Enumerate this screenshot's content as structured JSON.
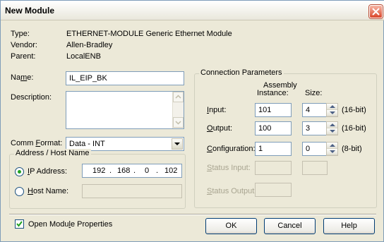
{
  "window": {
    "title": "New Module"
  },
  "info": {
    "type_label": "Type:",
    "type_value": "ETHERNET-MODULE Generic Ethernet Module",
    "vendor_label": "Vendor:",
    "vendor_value": "Allen-Bradley",
    "parent_label": "Parent:",
    "parent_value": "LocalENB"
  },
  "name": {
    "label_pre": "Na",
    "label_ul": "m",
    "label_post": "e:",
    "value": "IL_EIP_BK"
  },
  "description": {
    "label": "Description:",
    "value": ""
  },
  "comm_format": {
    "label_pre": "Comm ",
    "label_ul": "F",
    "label_post": "ormat:",
    "value": "Data - INT"
  },
  "address_group": {
    "title": "Address / Host Name",
    "ip_label_pre": "",
    "ip_label_ul": "I",
    "ip_label_post": "P Address:",
    "ip_octets": [
      "192",
      "168",
      "0",
      "102"
    ],
    "ip_selected": true,
    "host_label_pre": "",
    "host_label_ul": "H",
    "host_label_post": "ost Name:",
    "host_value": ""
  },
  "connection": {
    "title": "Connection Parameters",
    "col_assembly_line1": "Assembly",
    "col_assembly_line2": "Instance:",
    "col_size": "Size:",
    "rows": [
      {
        "label_ul": "I",
        "label_post": "nput:",
        "instance": "101",
        "size": "4",
        "unit": "(16-bit)",
        "enabled": true
      },
      {
        "label_ul": "O",
        "label_post": "utput:",
        "instance": "100",
        "size": "3",
        "unit": "(16-bit)",
        "enabled": true
      },
      {
        "label_ul": "C",
        "label_post": "onfiguration:",
        "instance": "1",
        "size": "0",
        "unit": "(8-bit)",
        "enabled": true
      },
      {
        "label_ul": "S",
        "label_post": "tatus Input:",
        "instance": "",
        "size": "",
        "unit": "",
        "enabled": false
      },
      {
        "label_ul": "S",
        "label_post": "tatus Output:",
        "instance": "",
        "size": "",
        "unit": "",
        "enabled": false
      }
    ]
  },
  "footer": {
    "open_props_pre": "Open Modu",
    "open_props_ul": "l",
    "open_props_post": "e Properties",
    "open_props_checked": true,
    "ok_label": "OK",
    "cancel_label": "Cancel",
    "help_label": "Help"
  },
  "colors": {
    "title_close": "#d9452a",
    "field_border": "#7f9db9",
    "dialog_bg": "#ece9d8"
  },
  "icons": [
    "close-icon",
    "scroll-up-icon",
    "scroll-down-icon",
    "dropdown-arrow-icon",
    "spin-up-icon",
    "spin-down-icon",
    "checkmark-icon"
  ]
}
